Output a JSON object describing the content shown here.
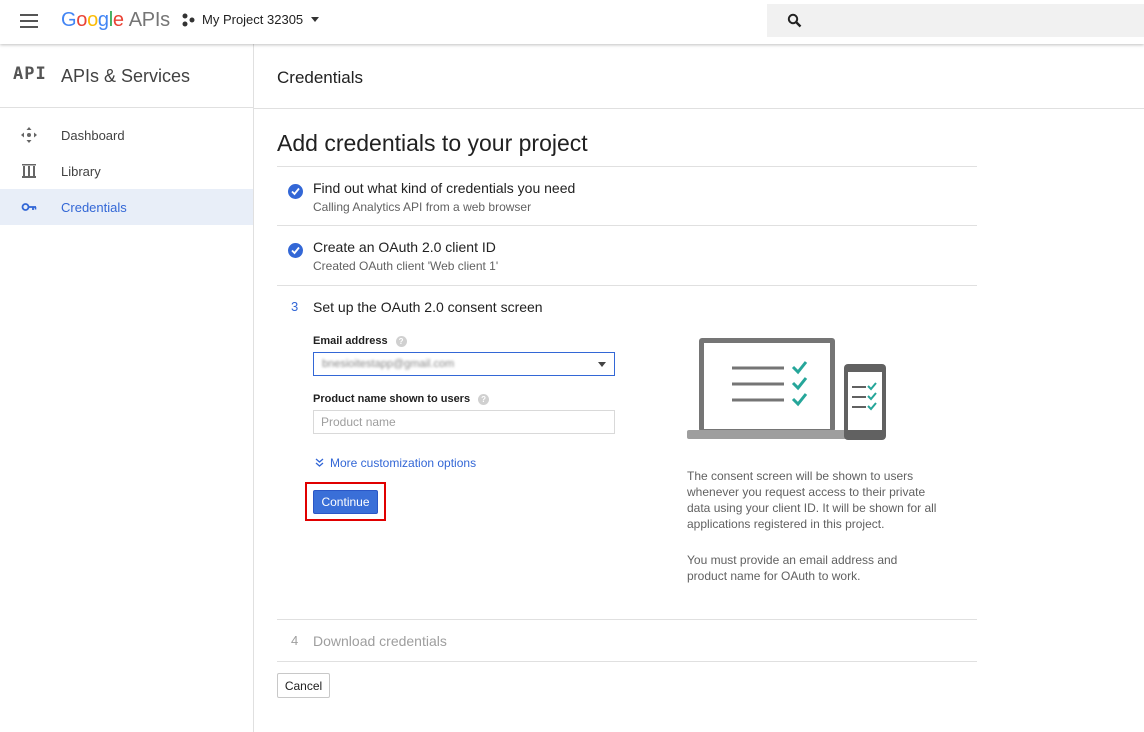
{
  "topbar": {
    "logo_letters": [
      "G",
      "o",
      "o",
      "g",
      "l",
      "e"
    ],
    "logo_suffix": "APIs",
    "project_name": "My Project 32305"
  },
  "sidebar": {
    "logo_text": "API",
    "title": "APIs & Services",
    "items": [
      {
        "label": "Dashboard",
        "icon": "dashboard-icon",
        "active": false
      },
      {
        "label": "Library",
        "icon": "library-icon",
        "active": false
      },
      {
        "label": "Credentials",
        "icon": "key-icon",
        "active": true
      }
    ]
  },
  "main": {
    "page_title": "Credentials",
    "heading": "Add credentials to your project",
    "steps": [
      {
        "marker": "check",
        "title": "Find out what kind of credentials you need",
        "subtitle": "Calling Analytics API from a web browser"
      },
      {
        "marker": "check",
        "title": "Create an OAuth 2.0 client ID",
        "subtitle": "Created OAuth client 'Web client 1'"
      },
      {
        "marker": "3",
        "title": "Set up the OAuth 2.0 consent screen"
      },
      {
        "marker": "4",
        "title": "Download credentials"
      }
    ],
    "form": {
      "email_label": "Email address",
      "email_value": "bnesioitestapp@gmail.com",
      "product_label": "Product name shown to users",
      "product_placeholder": "Product name",
      "more_options": "More customization options",
      "continue_label": "Continue"
    },
    "description": [
      "The consent screen will be shown to users whenever you request access to their private data using your client ID. It will be shown for all applications registered in this project.",
      "You must provide an email address and product name for OAuth to work."
    ],
    "cancel_label": "Cancel"
  },
  "colors": {
    "accent": "#3367d6",
    "highlight": "#e00000",
    "check_teal": "#26a69a"
  }
}
